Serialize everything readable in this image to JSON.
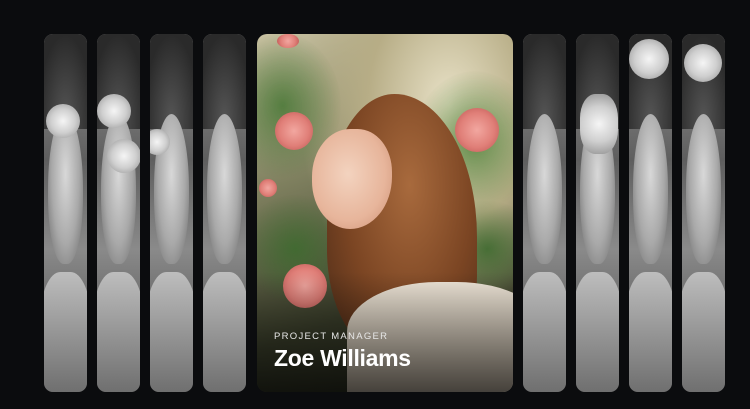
{
  "gallery": {
    "featured": {
      "role": "PROJECT MANAGER",
      "name": "Zoe Williams"
    },
    "colors": {
      "background": "#0b0c0e",
      "caption_text": "#ffffff"
    }
  }
}
